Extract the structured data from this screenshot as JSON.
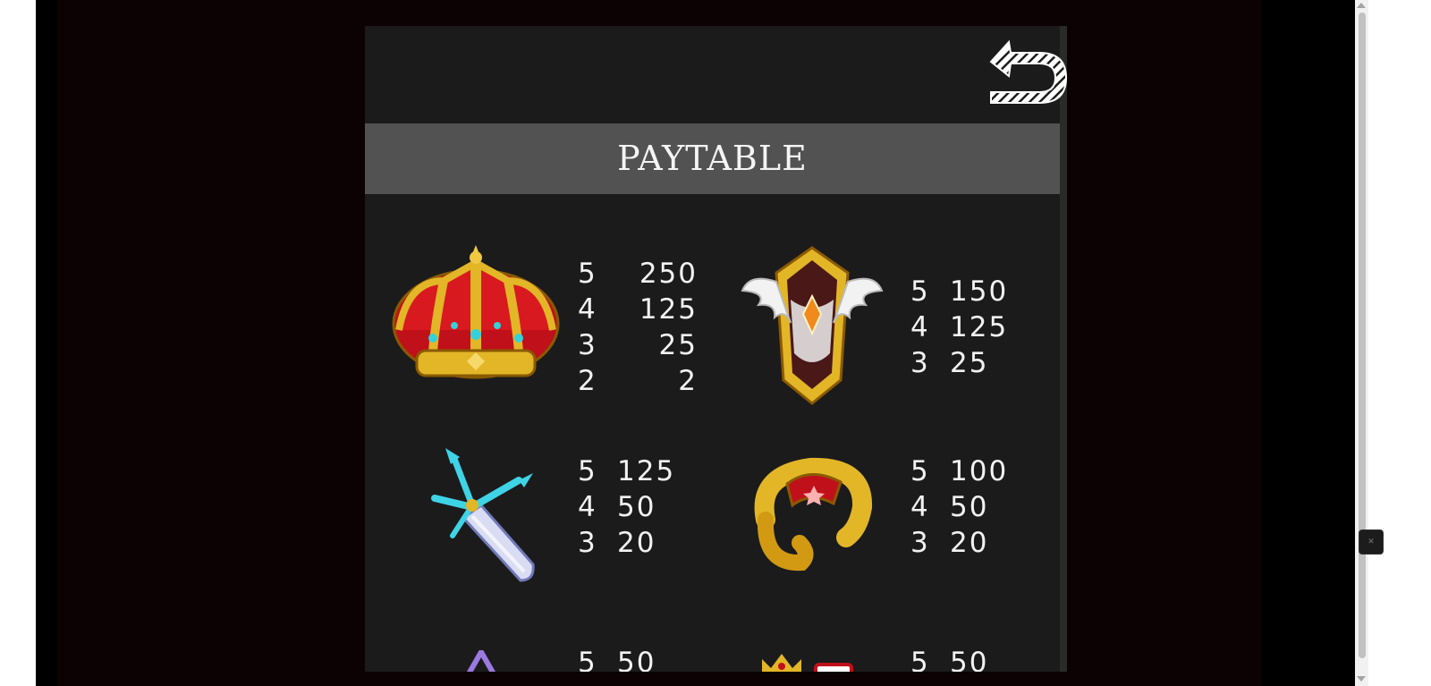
{
  "paytable": {
    "title": "PAYTABLE",
    "symbols": [
      {
        "name": "crown",
        "icon": "crown-icon",
        "payouts": [
          {
            "count": "5",
            "value": "250"
          },
          {
            "count": "4",
            "value": "125"
          },
          {
            "count": "3",
            "value": "25"
          },
          {
            "count": "2",
            "value": "2"
          }
        ]
      },
      {
        "name": "winged-shield",
        "icon": "winged-shield-icon",
        "payouts": [
          {
            "count": "5",
            "value": "150"
          },
          {
            "count": "4",
            "value": "125"
          },
          {
            "count": "3",
            "value": "25"
          }
        ]
      },
      {
        "name": "sword",
        "icon": "sword-icon",
        "payouts": [
          {
            "count": "5",
            "value": "125"
          },
          {
            "count": "4",
            "value": "50"
          },
          {
            "count": "3",
            "value": "20"
          }
        ]
      },
      {
        "name": "ring",
        "icon": "ring-icon",
        "payouts": [
          {
            "count": "5",
            "value": "100"
          },
          {
            "count": "4",
            "value": "50"
          },
          {
            "count": "3",
            "value": "20"
          }
        ]
      }
    ],
    "partial_row": {
      "left": {
        "count": "5",
        "value": "50"
      },
      "right": {
        "count": "5",
        "value": "50"
      }
    }
  },
  "colors": {
    "panel": "#1b1b1c",
    "title_bar": "#525252",
    "gold": "#e2b627",
    "crown_red": "#c0101a",
    "sword_cyan": "#3fd3e6"
  },
  "side_widget": {
    "label": "✕"
  }
}
